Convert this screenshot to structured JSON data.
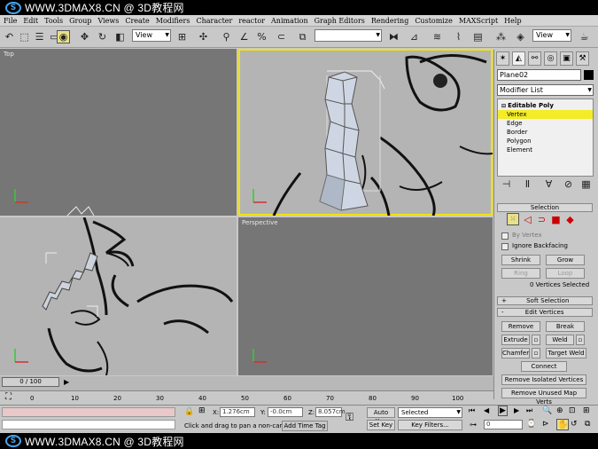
{
  "watermark": {
    "top": "WWW.3DMAX8.CN @ 3D教程网",
    "bottom": "WWW.3DMAX8.CN @ 3D教程网"
  },
  "menu": [
    "File",
    "Edit",
    "Tools",
    "Group",
    "Views",
    "Create",
    "Modifiers",
    "Character",
    "reactor",
    "Animation",
    "Graph Editors",
    "Rendering",
    "Customize",
    "MAXScript",
    "Help"
  ],
  "toolbar": {
    "ref_coord": "View",
    "selection_set": "",
    "view_dropdown": "View"
  },
  "viewports": {
    "top": "Top",
    "perspective": "Perspective"
  },
  "command_panel": {
    "object_name": "Plane02",
    "modifier_list": "Modifier List",
    "stack": [
      "Editable Poly",
      "Vertex",
      "Edge",
      "Border",
      "Polygon",
      "Element"
    ],
    "selection_title": "Selection",
    "by_vertex": "By Vertex",
    "ignore_backfacing": "Ignore Backfacing",
    "shrink": "Shrink",
    "grow": "Grow",
    "ring": "Ring",
    "loop": "Loop",
    "vertices_selected": "0 Vertices Selected",
    "soft_selection": "Soft Selection",
    "edit_vertices": "Edit Vertices",
    "remove": "Remove",
    "break": "Break",
    "extrude": "Extrude",
    "weld": "Weld",
    "chamfer": "Chamfer",
    "target_weld": "Target Weld",
    "connect": "Connect",
    "remove_isolated": "Remove Isolated Vertices",
    "remove_unused": "Remove Unused Map Verts"
  },
  "timeline": {
    "frame": "0 / 100",
    "ticks": [
      "0",
      "10",
      "20",
      "30",
      "40",
      "50",
      "60",
      "70",
      "80",
      "90",
      "100"
    ]
  },
  "status": {
    "x_label": "X:",
    "x_value": "1.276cm",
    "y_label": "Y:",
    "y_value": "-0.0cm",
    "z_label": "Z:",
    "z_value": "8.057cm",
    "prompt": "Click and drag to pan a non-camer",
    "add_time_tag": "Add Time Tag",
    "auto_key": "Auto Key",
    "set_key": "Set Key",
    "selected": "Selected",
    "key_filters": "Key Filters...",
    "frame_field": "0"
  }
}
